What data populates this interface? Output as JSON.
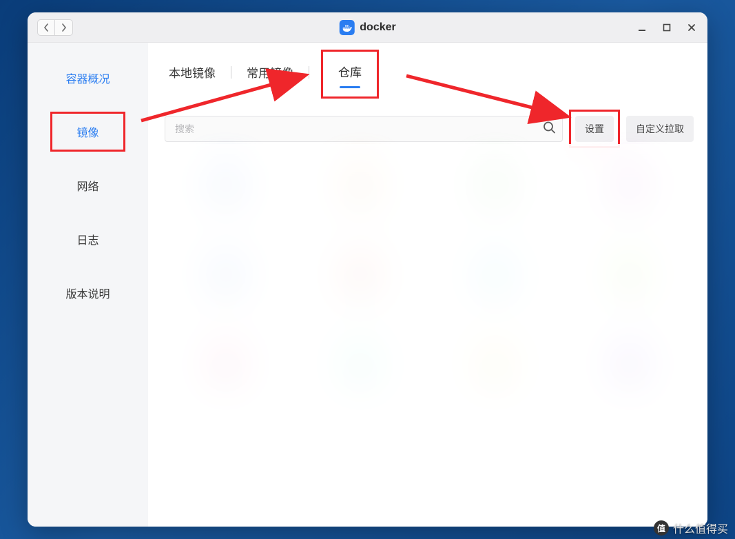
{
  "titlebar": {
    "app_name": "docker"
  },
  "sidebar": {
    "items": [
      {
        "label": "容器概况"
      },
      {
        "label": "镜像"
      },
      {
        "label": "网络"
      },
      {
        "label": "日志"
      },
      {
        "label": "版本说明"
      }
    ]
  },
  "tabs": [
    {
      "label": "本地镜像"
    },
    {
      "label": "常用镜像"
    },
    {
      "label": "仓库"
    }
  ],
  "toolbar": {
    "search_placeholder": "搜索",
    "settings_label": "设置",
    "custom_pull_label": "自定义拉取"
  },
  "watermark": {
    "badge": "值",
    "text": "什么值得买"
  },
  "annotations": {
    "highlight_color": "#ef262b",
    "arrow_color": "#ef262b"
  }
}
